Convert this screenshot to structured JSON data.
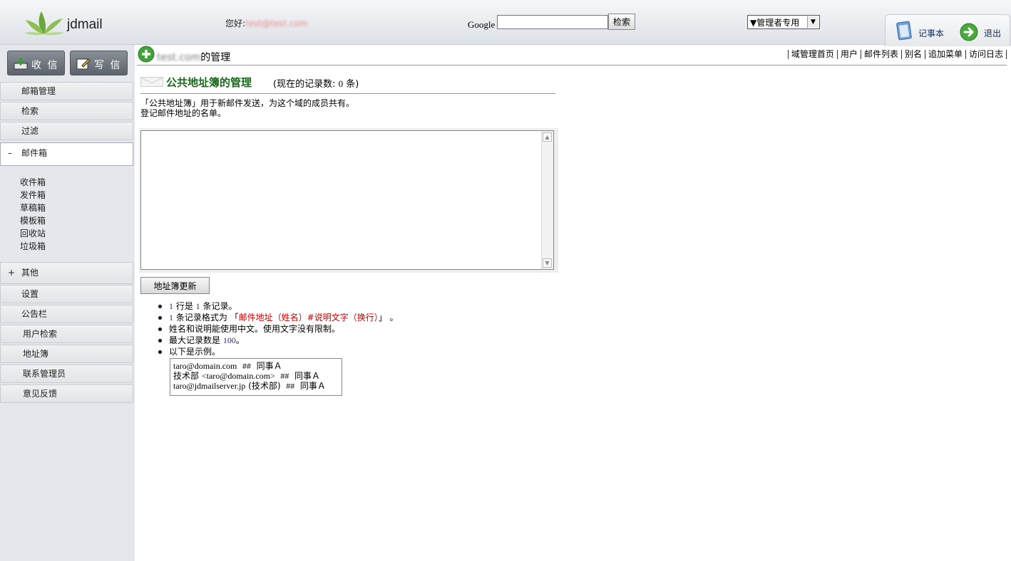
{
  "header": {
    "logo_text": "jdmail",
    "greeting_prefix": "您好:",
    "greeting_user": "test@test.com",
    "google_label": "Google",
    "search_button": "检索",
    "admin_select_value": "▼管理者专用",
    "notepad_label": "记事本",
    "logout_label": "退出"
  },
  "sidebar": {
    "receive_button": "收 信",
    "compose_button": "写 信",
    "nav_top": [
      "邮箱管理",
      "检索",
      "过滤"
    ],
    "mailbox": {
      "sign": "–",
      "label": "邮件箱",
      "folders": [
        "收件箱",
        "发件箱",
        "草稿箱",
        "模板箱",
        "回收站",
        "垃圾箱"
      ]
    },
    "other": {
      "sign": "+",
      "label": "其他",
      "items": [
        "设置",
        "公告栏",
        "用户检索",
        "地址簿",
        "联系管理员",
        "意见反馈"
      ]
    }
  },
  "topbar": {
    "domain_name": "test.com",
    "title_suffix": "的管理",
    "links": [
      "域管理首页",
      "用户",
      "邮件列表",
      "别名",
      "追加菜单",
      "访问日志"
    ]
  },
  "section": {
    "title": "公共地址簿的管理",
    "count_prefix": "(现在的记录数:",
    "count_value": "0",
    "count_suffix": "条)",
    "description_line1": "「公共地址簿」用于新邮件发送，为这个域的成员共有。",
    "description_line2": "登记邮件地址的名单。",
    "textarea_value": "",
    "update_button": "地址簿更新"
  },
  "notes": {
    "line1": {
      "n1": "1",
      "t1": "行是",
      "n2": "1",
      "t2": "条记录。"
    },
    "line2": {
      "n1": "1",
      "t1": "条记录格式为 「",
      "red": "邮件地址（姓名）#说明文字（换行）",
      "t2": "」 。"
    },
    "line3": "姓名和说明能使用中文。使用文字没有限制。",
    "line4": {
      "t1": "最大记录数是",
      "n1": "100",
      "t2": "。"
    },
    "line5": "以下是示例。"
  },
  "example": {
    "row1": {
      "addr": "taro@domain.com",
      "sep": "##",
      "note": "同事Ａ"
    },
    "row2": {
      "name": "技术部",
      "addr": "<taro@domain.com>",
      "sep": "##",
      "note": "同事Ａ"
    },
    "row3": {
      "addr": "taro@jdmailserver.jp",
      "name": "(技术部)",
      "sep": "##",
      "note": "同事Ａ"
    }
  }
}
